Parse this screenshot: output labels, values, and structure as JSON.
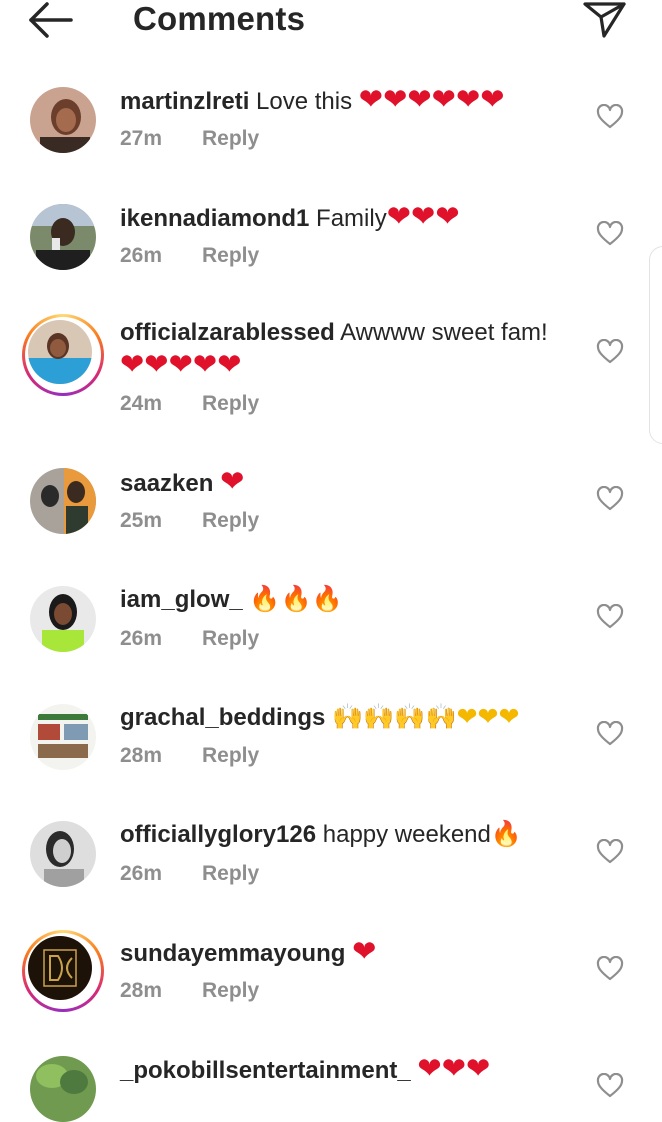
{
  "header": {
    "title": "Comments",
    "back_icon": "arrow-left-icon",
    "share_icon": "paper-plane-icon"
  },
  "reply_label": "Reply",
  "colors": {
    "text": "#262626",
    "meta": "#8e8e8e",
    "heart": "#e0112b"
  },
  "comments": [
    {
      "username": "martinzlreti",
      "text": "Love this ",
      "emojis": "❤❤❤❤❤❤",
      "time": "27m",
      "story": false
    },
    {
      "username": "ikennadiamond1",
      "text": "Family",
      "emojis": "❤❤❤",
      "time": "26m",
      "story": false
    },
    {
      "username": "officialzarablessed",
      "text": "Awwww sweet fam!",
      "emojis": "❤❤❤❤❤",
      "time": "24m",
      "story": true
    },
    {
      "username": "saazken",
      "text": "",
      "emojis": "❤",
      "time": "25m",
      "story": false
    },
    {
      "username": "iam_glow_",
      "text": "",
      "emojis": "🔥🔥🔥",
      "time": "26m",
      "story": false
    },
    {
      "username": "grachal_beddings",
      "text": "",
      "emojis": "🙌🙌🙌🙌❤❤❤",
      "time": "28m",
      "story": false
    },
    {
      "username": "officiallyglory126",
      "text": "happy weekend",
      "emojis": "🔥",
      "time": "26m",
      "story": false
    },
    {
      "username": "sundayemmayoung",
      "text": "",
      "emojis": "❤",
      "time": "28m",
      "story": true
    },
    {
      "username": "_pokobillsentertainment_",
      "text": "",
      "emojis": "❤❤❤",
      "time": "",
      "story": false
    }
  ]
}
